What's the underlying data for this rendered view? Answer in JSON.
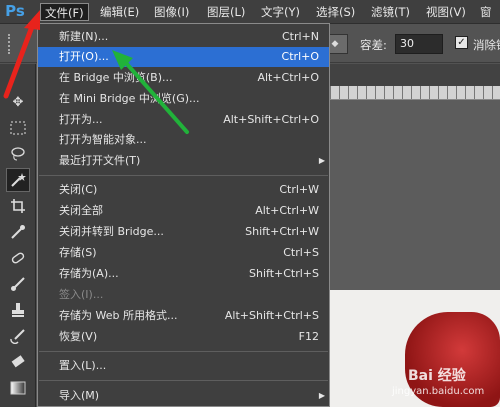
{
  "app": {
    "logo": "Ps"
  },
  "menubar": {
    "items": [
      "文件(F)",
      "编辑(E)",
      "图像(I)",
      "图层(L)",
      "文字(Y)",
      "选择(S)",
      "滤镜(T)",
      "视图(V)",
      "窗"
    ]
  },
  "options": {
    "tolerance_label": "容差:",
    "tolerance_value": "30",
    "antialias_label": "消除锯",
    "antialias_checked": true
  },
  "file_menu": {
    "items": [
      {
        "label": "新建(N)...",
        "shortcut": "Ctrl+N"
      },
      {
        "label": "打开(O)...",
        "shortcut": "Ctrl+O",
        "highlighted": true
      },
      {
        "label": "在 Bridge 中浏览(B)...",
        "shortcut": "Alt+Ctrl+O"
      },
      {
        "label": "在 Mini Bridge 中浏览(G)...",
        "shortcut": ""
      },
      {
        "label": "打开为...",
        "shortcut": "Alt+Shift+Ctrl+O"
      },
      {
        "label": "打开为智能对象...",
        "shortcut": ""
      },
      {
        "label": "最近打开文件(T)",
        "shortcut": "",
        "submenu": true
      },
      {
        "label": "关闭(C)",
        "shortcut": "Ctrl+W"
      },
      {
        "label": "关闭全部",
        "shortcut": "Alt+Ctrl+W"
      },
      {
        "label": "关闭并转到 Bridge...",
        "shortcut": "Shift+Ctrl+W"
      },
      {
        "label": "存储(S)",
        "shortcut": "Ctrl+S"
      },
      {
        "label": "存储为(A)...",
        "shortcut": "Shift+Ctrl+S"
      },
      {
        "label": "签入(I)...",
        "shortcut": "",
        "disabled": true
      },
      {
        "label": "存储为 Web 所用格式...",
        "shortcut": "Alt+Shift+Ctrl+S"
      },
      {
        "label": "恢复(V)",
        "shortcut": "F12"
      },
      {
        "label": "置入(L)...",
        "shortcut": ""
      },
      {
        "label": "导入(M)",
        "shortcut": "",
        "submenu": true
      }
    ]
  },
  "watermark": {
    "line1": "Bai 经验",
    "line2": "jingyan.baidu.com"
  },
  "colors": {
    "highlight": "#2c6fd3",
    "annotation_red": "#e8231c",
    "annotation_green": "#21b23a",
    "photoshop_blue": "#46a0e6"
  }
}
